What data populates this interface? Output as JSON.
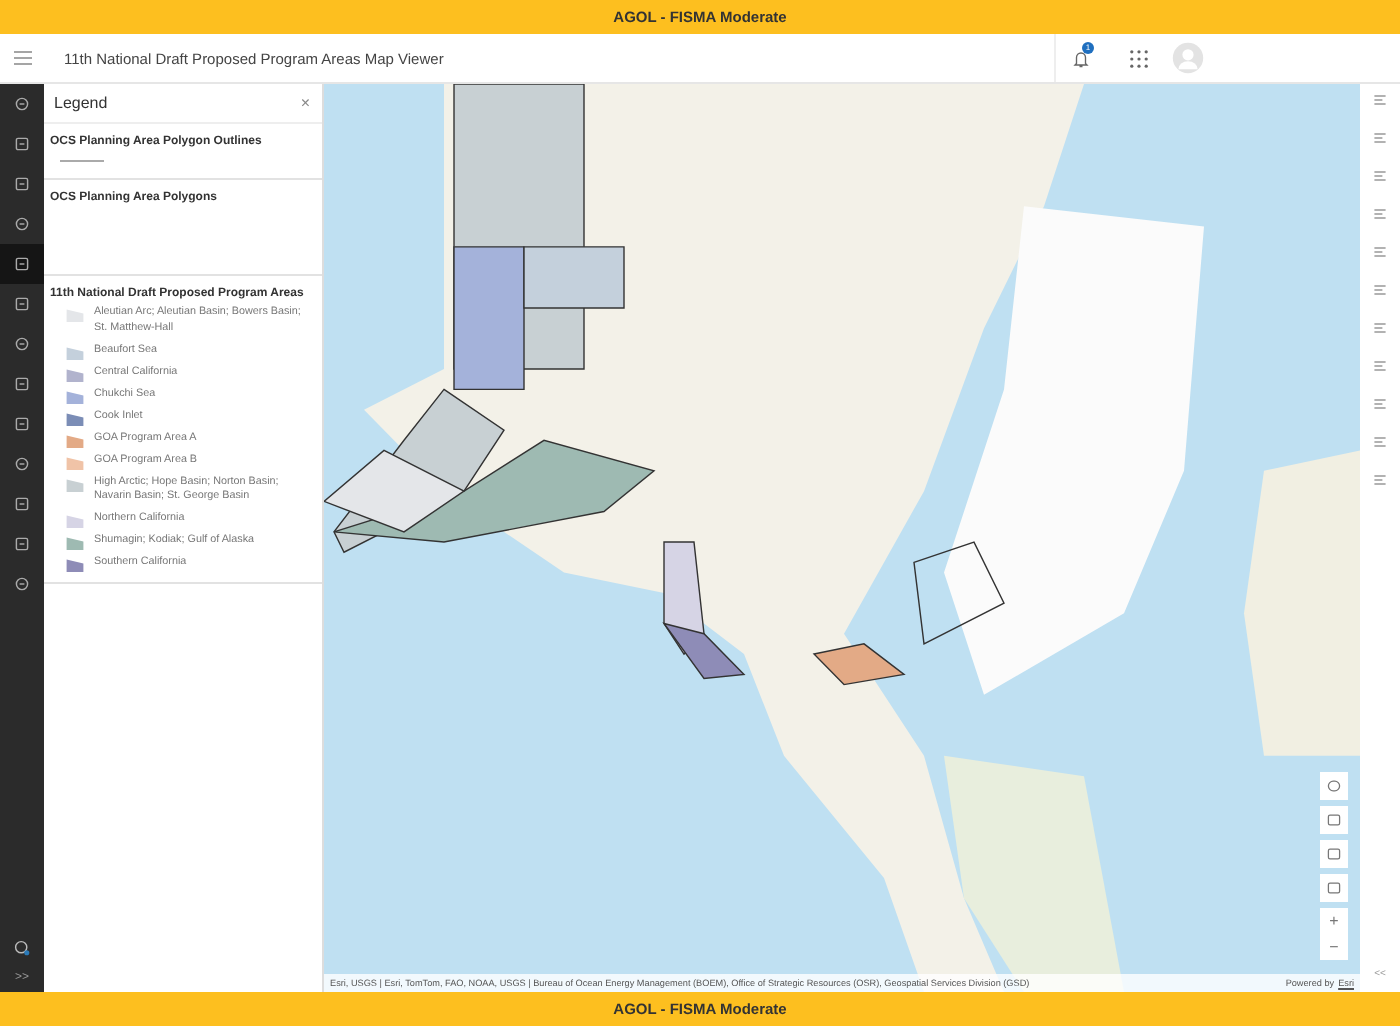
{
  "banner_top": "AGOL - FISMA Moderate",
  "header": {
    "title": "11th National Draft Proposed Program Areas Map Viewer",
    "notification_count": "1"
  },
  "legend": {
    "title": "Legend",
    "close": "×",
    "sections": [
      {
        "title": "OCS Planning Area Polygon Outlines",
        "kind": "outline"
      },
      {
        "title": "OCS Planning Area Polygons",
        "kind": "empty"
      },
      {
        "title": "11th National Draft Proposed Program Areas",
        "kind": "fills",
        "items": [
          {
            "label": "Aleutian Arc; Aleutian Basin; Bowers Basin; St. Matthew-Hall",
            "color": "#e4e6e9"
          },
          {
            "label": "Beaufort Sea",
            "color": "#c4d0dc"
          },
          {
            "label": "Central California",
            "color": "#b1b3cd"
          },
          {
            "label": "Chukchi Sea",
            "color": "#a4b2da"
          },
          {
            "label": "Cook Inlet",
            "color": "#7b8db6"
          },
          {
            "label": "GOA Program Area A",
            "color": "#e3aa86"
          },
          {
            "label": "GOA Program Area B",
            "color": "#f0c3a7"
          },
          {
            "label": "High Arctic; Hope Basin; Norton Basin; Navarin Basin; St. George Basin",
            "color": "#c8d0d3"
          },
          {
            "label": "Northern California",
            "color": "#d6d4e5"
          },
          {
            "label": "Shumagin; Kodiak; Gulf of Alaska",
            "color": "#9ebab2"
          },
          {
            "label": "Southern California",
            "color": "#8e8cb7"
          }
        ]
      }
    ]
  },
  "attribution": "Esri, USGS | Esri, TomTom, FAO, NOAA, USGS | Bureau of Ocean Energy Management (BOEM), Office of Strategic Resources (OSR), Geospatial Services Division (GSD)",
  "powered_by": {
    "text": "Powered by",
    "link": "Esri"
  },
  "zoom_in": "+",
  "zoom_out": "−",
  "collapse": "<<",
  "expand": ">>",
  "banner_bottom": "AGOL - FISMA Moderate"
}
